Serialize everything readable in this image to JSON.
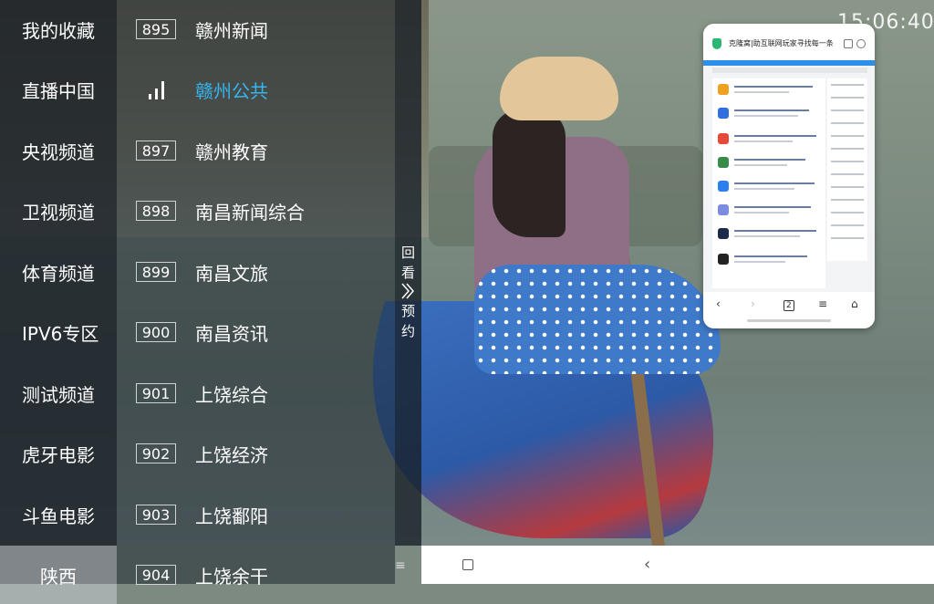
{
  "clock": "15:06:40",
  "categories": [
    {
      "label": "我的收藏",
      "active": false
    },
    {
      "label": "直播中国",
      "active": false
    },
    {
      "label": "央视频道",
      "active": false
    },
    {
      "label": "卫视频道",
      "active": false
    },
    {
      "label": "体育频道",
      "active": false
    },
    {
      "label": "IPV6专区",
      "active": false
    },
    {
      "label": "测试频道",
      "active": false
    },
    {
      "label": "虎牙电影",
      "active": false
    },
    {
      "label": "斗鱼电影",
      "active": false
    },
    {
      "label": "陕西",
      "active": true
    }
  ],
  "channels": [
    {
      "number": "895",
      "name": "赣州新闻",
      "playing": false
    },
    {
      "number": "",
      "name": "赣州公共",
      "playing": true
    },
    {
      "number": "897",
      "name": "赣州教育",
      "playing": false
    },
    {
      "number": "898",
      "name": "南昌新闻综合",
      "playing": false
    },
    {
      "number": "899",
      "name": "南昌文旅",
      "playing": false
    },
    {
      "number": "900",
      "name": "南昌资讯",
      "playing": false
    },
    {
      "number": "901",
      "name": "上饶综合",
      "playing": false
    },
    {
      "number": "902",
      "name": "上饶经济",
      "playing": false
    },
    {
      "number": "903",
      "name": "上饶鄱阳",
      "playing": false
    },
    {
      "number": "904",
      "name": "上饶余干",
      "playing": false
    }
  ],
  "side_strip": {
    "line1": "回",
    "line2": "看",
    "line3": "预",
    "line4": "约"
  },
  "menu_glyph": "≡",
  "floating_window": {
    "title": "克隆窝|助互联网玩家寻找每一条",
    "tab_count": "2"
  },
  "colors": {
    "active_channel": "#35b6f0",
    "highlight_row": "#c8cdd2"
  }
}
